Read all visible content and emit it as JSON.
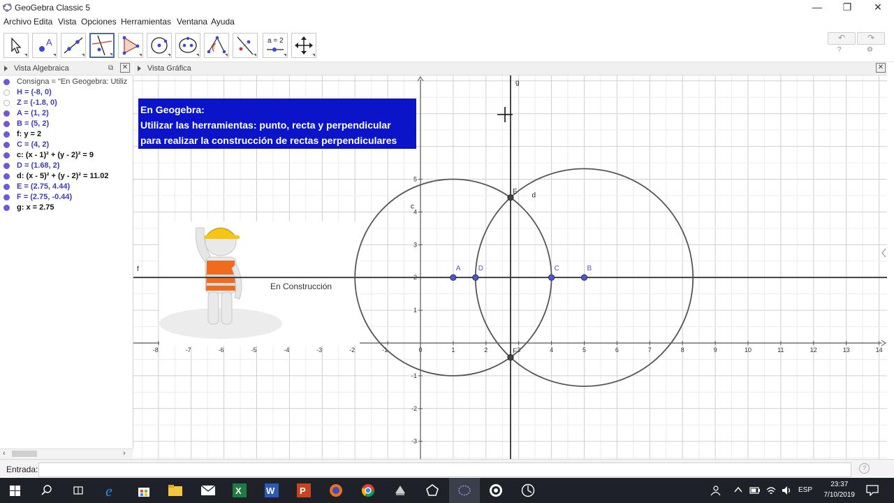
{
  "window": {
    "title": "GeoGebra Classic 5",
    "minimize": "—",
    "maximize": "❐",
    "close": "✕"
  },
  "menu": [
    "Archivo",
    "Edita",
    "Vista",
    "Opciones",
    "Herramientas",
    "Ventana",
    "Ayuda"
  ],
  "toolbar": {
    "tools": [
      "move-tool",
      "point-tool",
      "line-tool",
      "perpendicular-line-tool",
      "polygon-tool",
      "circle-tool",
      "conic-tool",
      "angle-tool",
      "reflect-tool",
      "slider-tool",
      "move-graphics-tool"
    ],
    "slider_label": "a = 2",
    "undo": "↶",
    "redo": "↷",
    "help": "?",
    "settings": "⚙"
  },
  "algebra_view": {
    "title": "Vista Algebraica",
    "items": [
      {
        "text": "Consigna = \"En Geogebra: Utiliz",
        "kind": "text",
        "visible": true
      },
      {
        "text": "H = (-8, 0)",
        "kind": "point",
        "visible": false
      },
      {
        "text": "Z = (-1.8, 0)",
        "kind": "point",
        "visible": false
      },
      {
        "text": "A = (1, 2)",
        "kind": "point",
        "visible": true
      },
      {
        "text": "B = (5, 2)",
        "kind": "point",
        "visible": true
      },
      {
        "text": "f: y = 2",
        "kind": "line",
        "visible": true
      },
      {
        "text": "C = (4, 2)",
        "kind": "point",
        "visible": true
      },
      {
        "text": "c: (x - 1)² + (y - 2)² = 9",
        "kind": "line",
        "visible": true
      },
      {
        "text": "D = (1.68, 2)",
        "kind": "point",
        "visible": true
      },
      {
        "text": "d: (x - 5)² + (y - 2)² = 11.02",
        "kind": "line",
        "visible": true
      },
      {
        "text": "E = (2.75, 4.44)",
        "kind": "point",
        "visible": true
      },
      {
        "text": "F = (2.75, -0.44)",
        "kind": "point",
        "visible": true
      },
      {
        "text": "g: x = 2.75",
        "kind": "line",
        "visible": true
      }
    ]
  },
  "graphics_view": {
    "title": "Vista Gráfica",
    "consigna": [
      "En Geogebra:",
      "Utilizar las herramientas: punto, recta y perpendicular",
      "para realizar la construcción de rectas perpendiculares"
    ],
    "image_caption": "En Construcción",
    "x_ticks": [
      "-8",
      "-7",
      "-6",
      "-5",
      "-4",
      "-3",
      "-2",
      "-1",
      "0",
      "1",
      "2",
      "3",
      "4",
      "5",
      "6",
      "7",
      "8",
      "9",
      "10",
      "11",
      "12",
      "13",
      "14"
    ],
    "y_ticks": [
      "-3",
      "-2",
      "-1",
      "1",
      "2",
      "3",
      "4",
      "5"
    ],
    "points": [
      {
        "name": "A",
        "x": 1,
        "y": 2
      },
      {
        "name": "B",
        "x": 5,
        "y": 2
      },
      {
        "name": "C",
        "x": 4,
        "y": 2
      },
      {
        "name": "D",
        "x": 1.68,
        "y": 2
      },
      {
        "name": "E",
        "x": 2.75,
        "y": 4.44
      },
      {
        "name": "F",
        "x": 2.75,
        "y": -0.44
      }
    ],
    "circles": [
      {
        "name": "c",
        "cx": 1,
        "cy": 2,
        "r": 3
      },
      {
        "name": "d",
        "cx": 5,
        "cy": 2,
        "r": 3.32
      }
    ],
    "lines": [
      {
        "name": "f",
        "kind": "horizontal",
        "value": 2
      },
      {
        "name": "g",
        "kind": "vertical",
        "value": 2.75
      }
    ]
  },
  "input_bar": {
    "label": "Entrada:",
    "value": "",
    "help": "?"
  },
  "taskbar": {
    "time": "23:37",
    "date": "7/10/2019",
    "lang": "ESP"
  }
}
